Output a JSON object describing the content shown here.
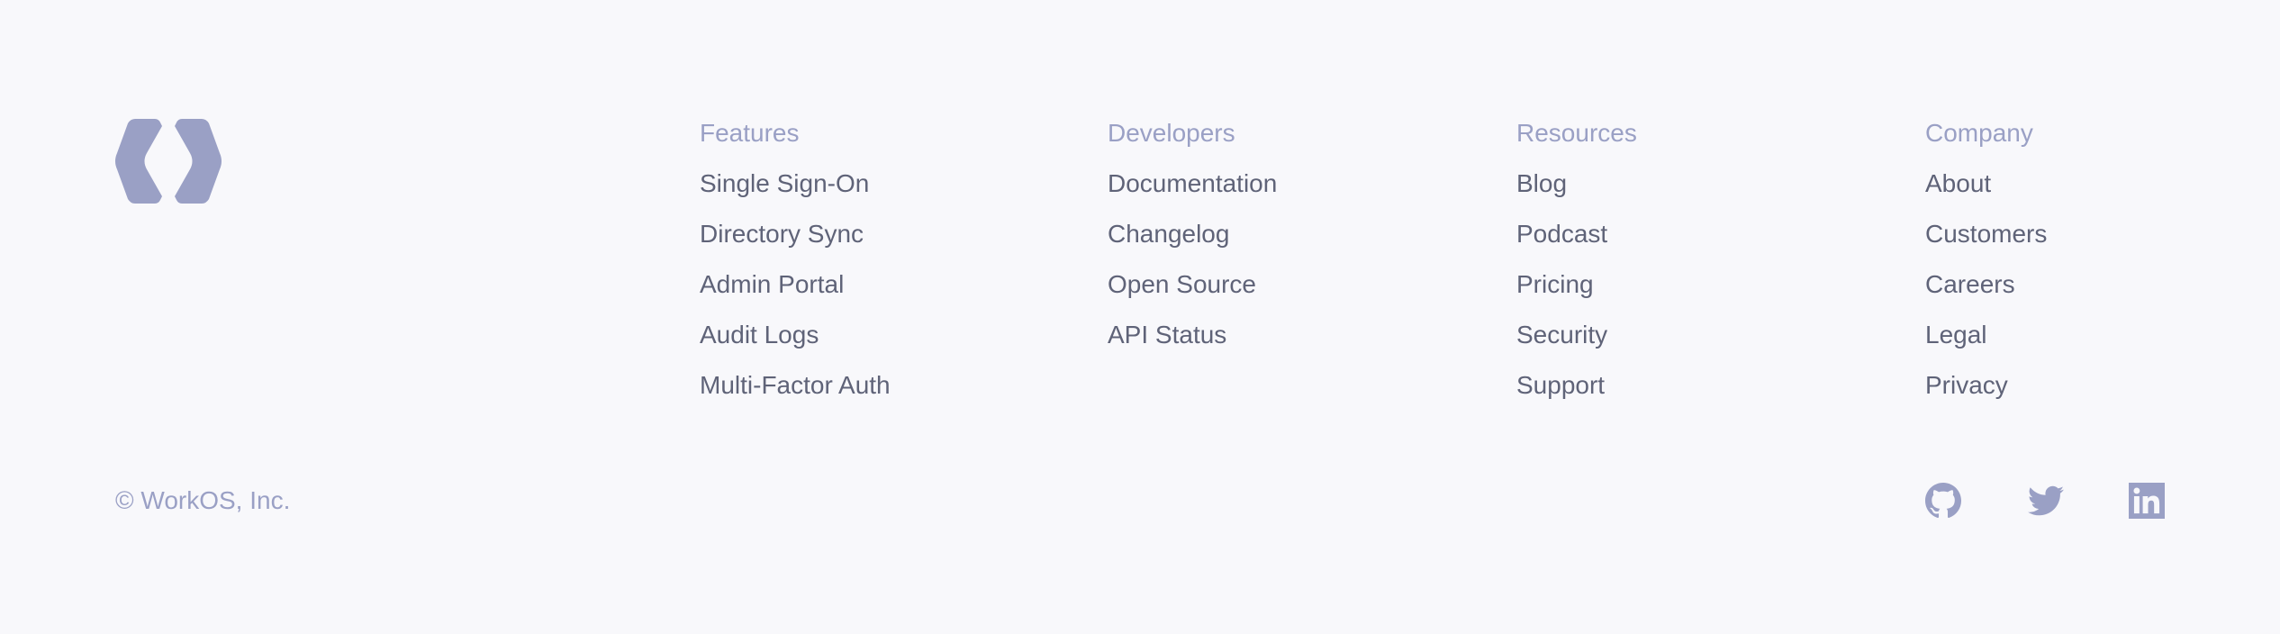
{
  "colors": {
    "background": "#f8f8fb",
    "brand": "#9aa0c5",
    "link_text": "#5f6378",
    "heading_text": "#9aa0c5"
  },
  "logo": {
    "icon": "workos-logo-icon"
  },
  "columns": [
    {
      "heading": "Features",
      "items": [
        "Single Sign-On",
        "Directory Sync",
        "Admin Portal",
        "Audit Logs",
        "Multi-Factor Auth"
      ]
    },
    {
      "heading": "Developers",
      "items": [
        "Documentation",
        "Changelog",
        "Open Source",
        "API Status"
      ]
    },
    {
      "heading": "Resources",
      "items": [
        "Blog",
        "Podcast",
        "Pricing",
        "Security",
        "Support"
      ]
    },
    {
      "heading": "Company",
      "items": [
        "About",
        "Customers",
        "Careers",
        "Legal",
        "Privacy"
      ]
    }
  ],
  "copyright": "© WorkOS, Inc.",
  "social": [
    {
      "icon": "github-icon"
    },
    {
      "icon": "twitter-icon"
    },
    {
      "icon": "linkedin-icon"
    }
  ]
}
